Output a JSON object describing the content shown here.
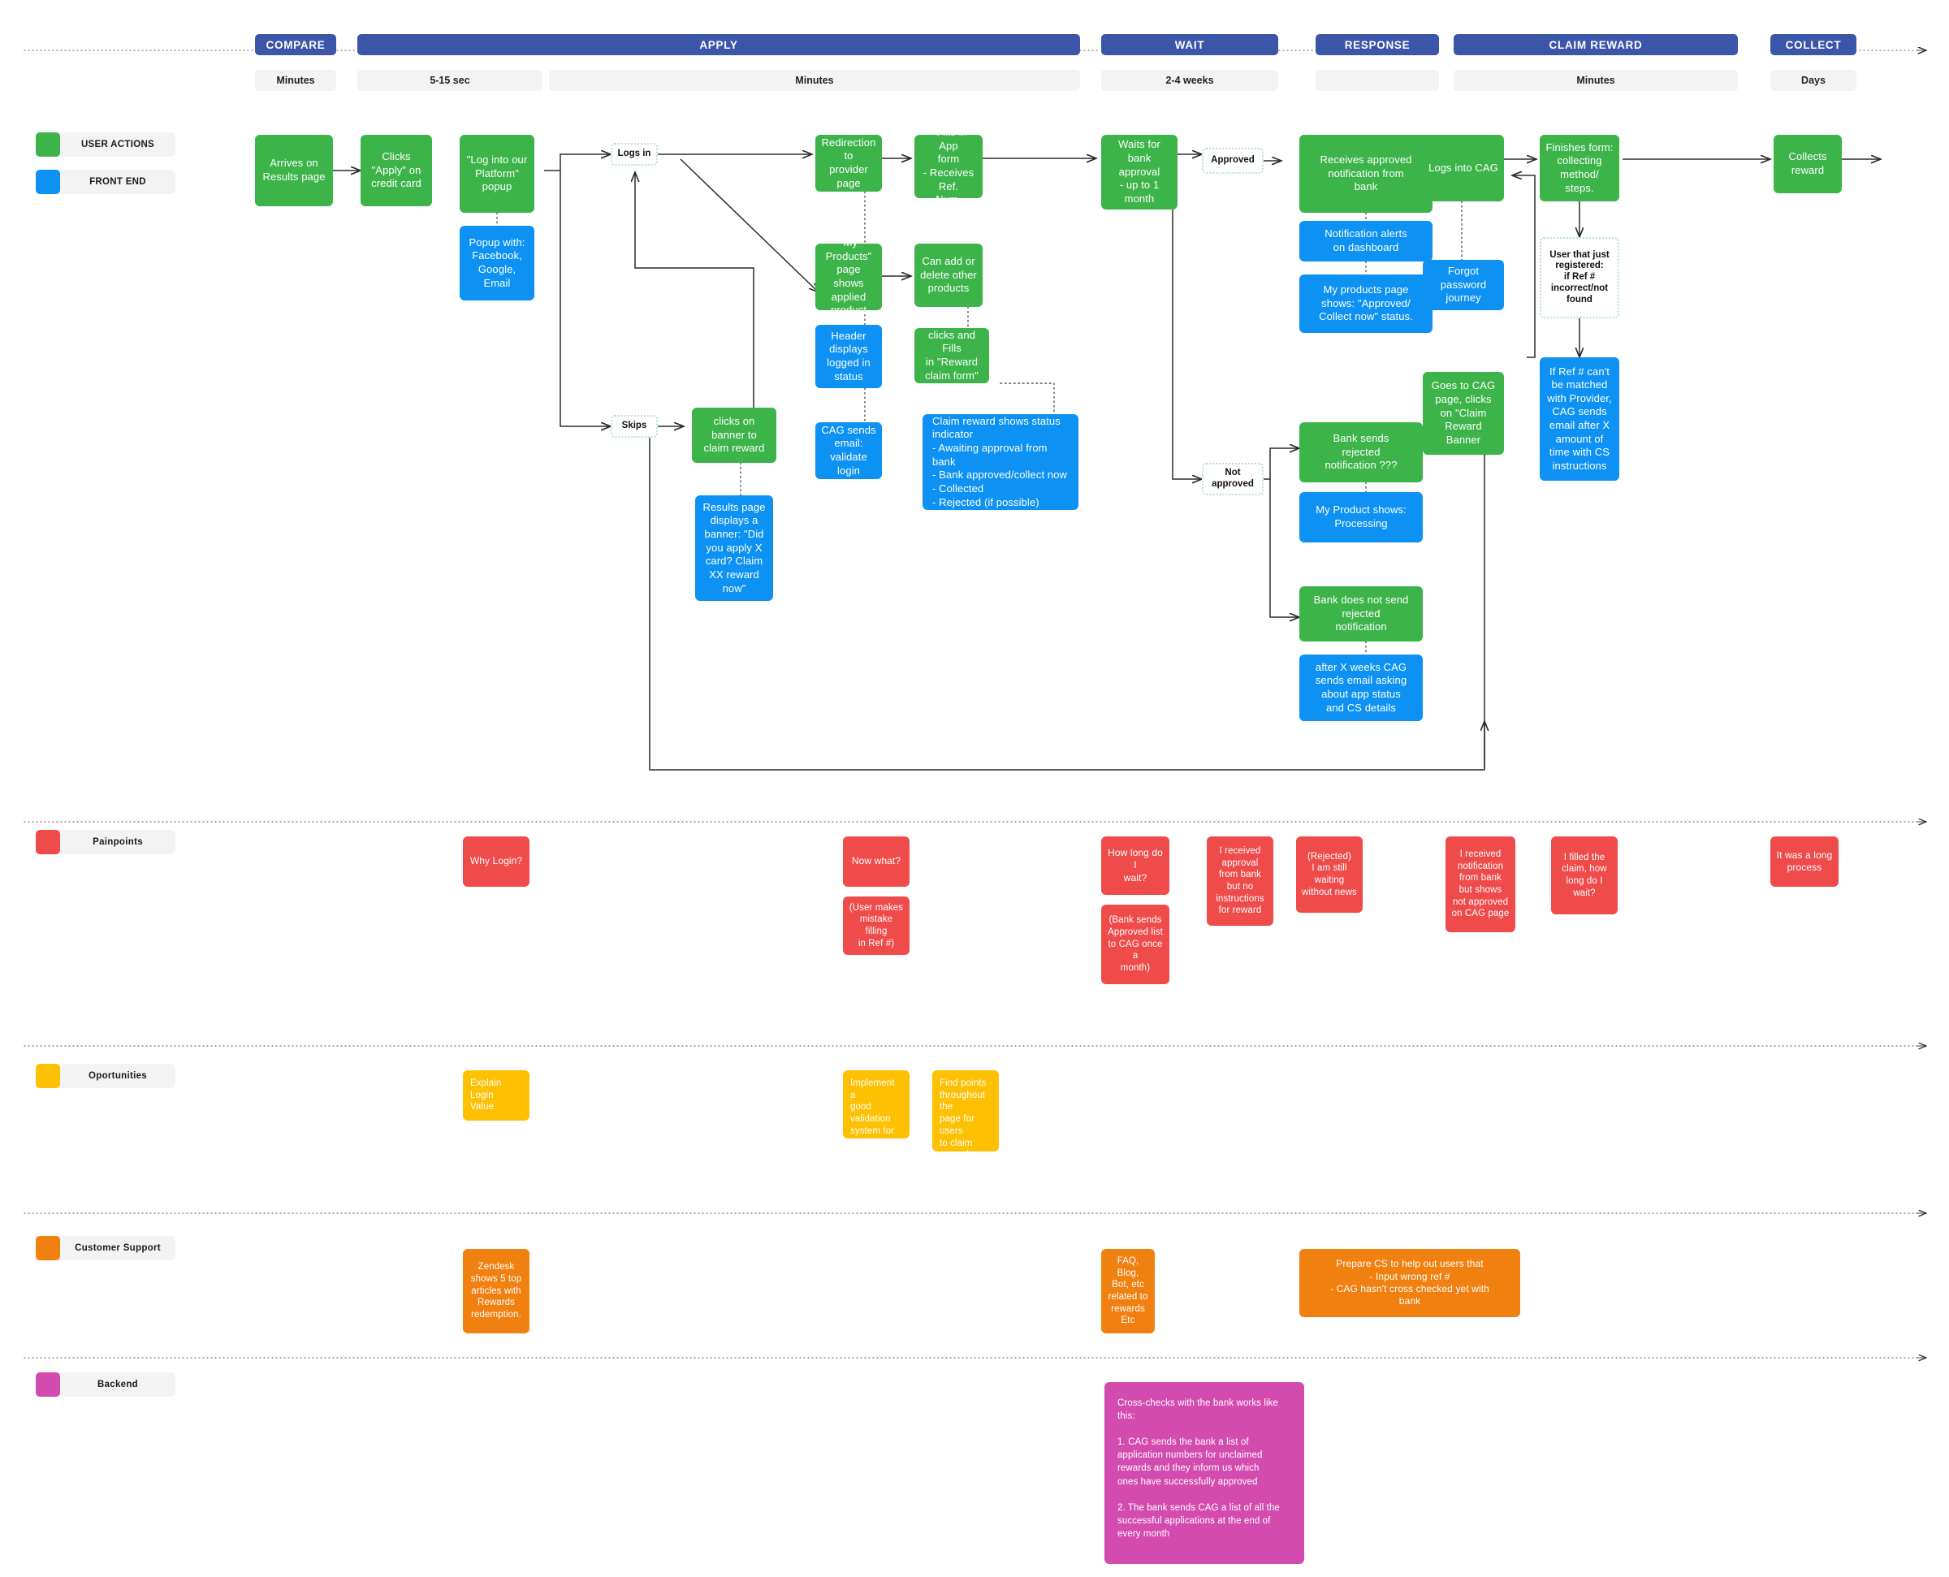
{
  "legend": [
    {
      "label": "USER ACTIONS",
      "color": "#3cb44a"
    },
    {
      "label": "FRONT END",
      "color": "#0d92f4"
    }
  ],
  "phases": [
    {
      "label": "COMPARE",
      "time": "Minutes"
    },
    {
      "label": "APPLY",
      "time": "5-15 sec"
    },
    {
      "label": "",
      "time": "Minutes"
    },
    {
      "label": "WAIT",
      "time": "2-4 weeks"
    },
    {
      "label": "RESPONSE",
      "time": ""
    },
    {
      "label": "CLAIM REWARD",
      "time": "Minutes"
    },
    {
      "label": "COLLECT",
      "time": "Days"
    }
  ],
  "swimlanes": [
    {
      "label": "Painpoints",
      "color": "#ef4b4b"
    },
    {
      "label": "Oportunities",
      "color": "#fdc003"
    },
    {
      "label": "Customer Support",
      "color": "#f08010"
    },
    {
      "label": "Backend",
      "color": "#d44bb0"
    }
  ],
  "flow": {
    "n1": "Arrives on\nResults page",
    "n2": "Clicks\n\"Apply\" on\ncredit card",
    "n3": "\"Log into our\nPlatform\"\npopup",
    "n4": "Popup with:\nFacebook,\nGoogle,\nEmail",
    "chip_logs_in": "Logs in",
    "chip_skips": "Skips",
    "n5": "Redirection to\nprovider page",
    "n6": "- Fills in App\nform\n- Receives Ref.\nNum.",
    "n7": "\"My Products\"\npage shows\napplied\nproduct",
    "n8": "Can add or\ndelete other\nproducts",
    "n9": "Header\ndisplays\nlogged in\nstatus",
    "n10": "CAG sends\nemail:\nvalidate login",
    "n11": "clicks and Fills\nin \"Reward\nclaim form\"",
    "n12": "Claim reward shows status\nindicator\n- Awaiting approval from bank\n- Bank approved/collect now\n- Collected\n- Rejected (if possible)",
    "n13": "clicks on\nbanner to\nclaim reward",
    "n14": "Results page\ndisplays a\nbanner: \"Did\nyou apply X\ncard? Claim\nXX reward\nnow\"",
    "n15": "Waits for\nbank approval\n- up to 1\nmonth",
    "chip_approved": "Approved",
    "chip_not_approved": "Not\napproved",
    "n16": "Receives approved\nnotification from\nbank",
    "n17": "Notification alerts\non dashboard",
    "n18": "My products page\nshows: \"Approved/\nCollect now\" status.",
    "n19": "Bank sends\nrejected\nnotification ???",
    "n20": "My Product shows:\nProcessing",
    "n21": "Bank does not send\nrejected\nnotification",
    "n22": "after X weeks CAG\nsends email asking\nabout app status\nand CS details",
    "n23": "Logs into CAG",
    "n24": "Forgot\npassword\njourney",
    "n25": "Goes to CAG\npage, clicks\non \"Claim\nReward\nBanner",
    "n26": "Finishes form:\ncollecting\nmethod/\nsteps.",
    "chip_just_registered": "User that just\nregistered:\nif Ref #\nincorrect/not\nfound",
    "n27": "If Ref # can't\nbe matched\nwith Provider,\nCAG sends\nemail after X\namount of\ntime with CS\ninstructions",
    "n28": "Collects\nreward"
  },
  "painpoints": {
    "p1": "Why Login?",
    "p2": "Now what?",
    "p3": "(User makes\nmistake filling\nin Ref #)",
    "p4": "How long do I\nwait?",
    "p5": "(Bank sends\nApproved list\nto CAG once a\nmonth)",
    "p6": "I received\napproval\nfrom bank\nbut no\ninstructions\nfor reward",
    "p7": "(Rejected)\nI am still\nwaiting\nwithout news",
    "p8": "I received\nnotification\nfrom bank\nbut shows\nnot approved\non  CAG page",
    "p9": "I filled the\nclaim, how\nlong do I\nwait?",
    "p10": "It was a long\nprocess"
  },
  "opportunities": {
    "o1": "Explain Login\nValue",
    "o2": "Implement a\ngood validation\nsystem for the\nRef #",
    "o3": "Find points\nthroughout the\npage for users\nto claim\nrewards"
  },
  "customer_support": {
    "c1": "Zendesk\nshows 5 top\narticles with\nRewards\nredemption.",
    "c2": "FAQ, Blog,\nBot, etc\nrelated to\nrewards\nEtc",
    "c3": "Prepare CS to help out users that\n- Input wrong ref #\n- CAG hasn't cross checked yet with\nbank"
  },
  "backend": {
    "b1": "Cross-checks with the bank works like\nthis:\n\n1. CAG sends the bank a list of\napplication numbers for unclaimed\nrewards and they inform us which\nones have successfully approved\n\n2. The bank sends CAG a list of all the\nsuccessful applications at the end of\nevery month"
  }
}
